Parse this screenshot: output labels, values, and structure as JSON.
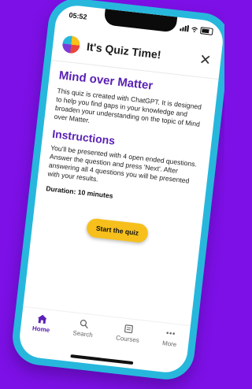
{
  "status_bar": {
    "time": "05:52"
  },
  "header": {
    "title": "It's Quiz Time!"
  },
  "quiz": {
    "title": "Mind over Matter",
    "description": "This quiz is created with ChatGPT. It is designed to help you find gaps in your knowledge and broaden your understanding on the topic of Mind over Matter.",
    "instructions_heading": "Instructions",
    "instructions_text": "You'll be presented with 4 open ended questions. Answer the question and press 'Next'. After answering all 4 questions you will be presented with your results.",
    "duration": "Duration: 10 minutes",
    "start_label": "Start the quiz"
  },
  "tabs": [
    {
      "label": "Home",
      "icon": "home-icon",
      "active": true
    },
    {
      "label": "Search",
      "icon": "search-icon",
      "active": false
    },
    {
      "label": "Courses",
      "icon": "book-icon",
      "active": false
    },
    {
      "label": "More",
      "icon": "more-icon",
      "active": false
    }
  ],
  "colors": {
    "background": "#7d10e6",
    "phone_frame": "#27b7dc",
    "accent": "#5b21b6",
    "button": "#f6bf1c"
  }
}
